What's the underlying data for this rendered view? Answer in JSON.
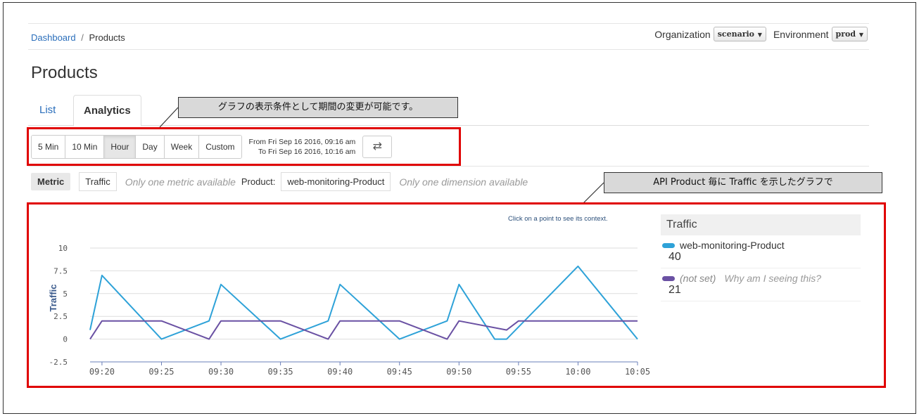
{
  "breadcrumb": {
    "home": "Dashboard",
    "sep": "/",
    "current": "Products"
  },
  "header": {
    "org_label": "Organization",
    "org_value": "scenario",
    "env_label": "Environment",
    "env_value": "prod"
  },
  "page_title": "Products",
  "tabs": [
    {
      "label": "List"
    },
    {
      "label": "Analytics"
    }
  ],
  "time_buttons": [
    {
      "label": "5 Min"
    },
    {
      "label": "10 Min"
    },
    {
      "label": "Hour",
      "active": true
    },
    {
      "label": "Day"
    },
    {
      "label": "Week"
    },
    {
      "label": "Custom"
    }
  ],
  "range": {
    "from": "From Fri Sep 16 2016, 09:16 am",
    "to": "To Fri Sep 16 2016, 10:16 am"
  },
  "metric": {
    "label": "Metric",
    "value": "Traffic",
    "note": "Only one metric available",
    "product_label": "Product:",
    "product_value": "web-monitoring-Product",
    "dim_note": "Only one dimension available"
  },
  "callouts": {
    "period": "グラフの表示条件として期間の変更が可能です。",
    "traffic": "API Product 毎に Traffic を示したグラフで"
  },
  "chart_hint": "Click on a point to see its context.",
  "legend": {
    "title": "Traffic",
    "items": [
      {
        "name": "web-monitoring-Product",
        "value": "40",
        "color": "#2ea2d8"
      },
      {
        "name": "(not set)",
        "value": "21",
        "color": "#6a51a3",
        "note": "Why am I seeing this?"
      }
    ]
  },
  "chart_data": {
    "type": "line",
    "ylabel": "Traffic",
    "ylim": [
      -2.5,
      10
    ],
    "yticks": [
      -2.5,
      0,
      2.5,
      5,
      7.5,
      10
    ],
    "ytick_labels": [
      "-2.5",
      "0",
      "2.5",
      "5",
      "7.5",
      "10"
    ],
    "xticks": [
      "09:20",
      "09:25",
      "09:30",
      "09:35",
      "09:40",
      "09:45",
      "09:50",
      "09:55",
      "10:00",
      "10:05"
    ],
    "x_range_minutes": [
      "09:19",
      "10:05"
    ],
    "series": [
      {
        "name": "web-monitoring-Product",
        "color": "#2ea2d8",
        "points": [
          [
            "09:19",
            1
          ],
          [
            "09:20",
            7
          ],
          [
            "09:25",
            0
          ],
          [
            "09:29",
            2
          ],
          [
            "09:30",
            6
          ],
          [
            "09:35",
            0
          ],
          [
            "09:39",
            2
          ],
          [
            "09:40",
            6
          ],
          [
            "09:45",
            0
          ],
          [
            "09:49",
            2
          ],
          [
            "09:50",
            6
          ],
          [
            "09:53",
            0
          ],
          [
            "09:54",
            0
          ],
          [
            "10:00",
            8
          ],
          [
            "10:05",
            0
          ]
        ]
      },
      {
        "name": "(not set)",
        "color": "#6a51a3",
        "points": [
          [
            "09:19",
            0
          ],
          [
            "09:20",
            2
          ],
          [
            "09:25",
            2
          ],
          [
            "09:29",
            0
          ],
          [
            "09:30",
            2
          ],
          [
            "09:35",
            2
          ],
          [
            "09:39",
            0
          ],
          [
            "09:40",
            2
          ],
          [
            "09:45",
            2
          ],
          [
            "09:49",
            0
          ],
          [
            "09:50",
            2
          ],
          [
            "09:54",
            1
          ],
          [
            "09:55",
            2
          ],
          [
            "10:00",
            2
          ],
          [
            "10:05",
            2
          ]
        ]
      }
    ]
  }
}
